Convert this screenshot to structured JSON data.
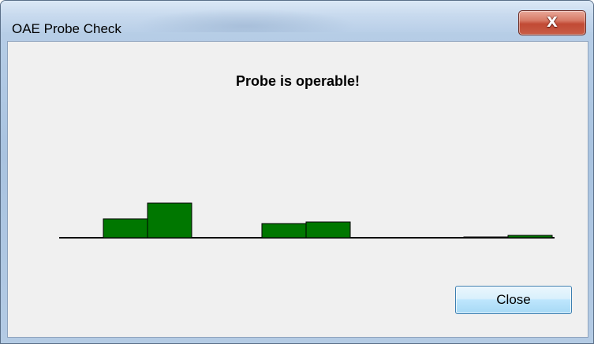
{
  "window": {
    "title": "OAE Probe Check",
    "close_glyph": "X"
  },
  "content": {
    "status": "Probe is operable!"
  },
  "actions": {
    "close_label": "Close"
  },
  "colors": {
    "bar_fill": "#007700",
    "bar_stroke": "#000000",
    "baseline": "#000000"
  },
  "icons": {
    "window_close": "close-icon"
  },
  "chart_data": {
    "type": "bar",
    "title": "",
    "xlabel": "",
    "ylabel": "",
    "ylim": [
      0,
      100
    ],
    "grid": false,
    "groups": [
      {
        "values": [
          48,
          88
        ]
      },
      {
        "values": [
          35,
          40
        ]
      },
      {
        "values": [
          0,
          5
        ]
      }
    ]
  }
}
